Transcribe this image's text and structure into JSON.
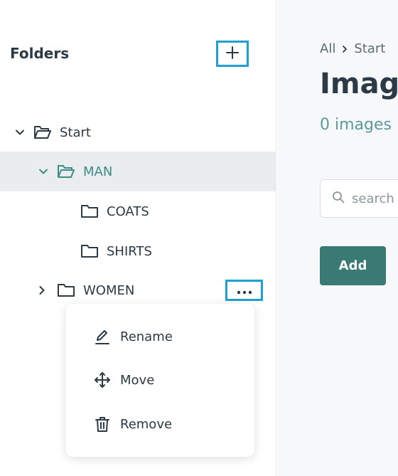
{
  "sidebar": {
    "title": "Folders",
    "add_folder_icon": "plus-icon",
    "tree": [
      {
        "label": "Start",
        "expanded": true,
        "icon": "folder-open-icon"
      },
      {
        "label": "MAN",
        "expanded": true,
        "selected": true,
        "icon": "folder-open-icon"
      },
      {
        "label": "COATS",
        "icon": "folder-icon"
      },
      {
        "label": "SHIRTS",
        "icon": "folder-icon"
      },
      {
        "label": "WOMEN",
        "expanded": false,
        "icon": "folder-icon"
      }
    ],
    "more_icon": "more-horizontal-icon"
  },
  "context_menu": {
    "items": [
      {
        "label": "Rename",
        "icon": "pencil-icon"
      },
      {
        "label": "Move",
        "icon": "move-arrows-icon"
      },
      {
        "label": "Remove",
        "icon": "trash-icon"
      }
    ]
  },
  "main": {
    "breadcrumb": [
      "All",
      "Start"
    ],
    "title": "Images",
    "count_text": "0 images",
    "search": {
      "placeholder": "search"
    },
    "add_label": "Add"
  },
  "colors": {
    "accent": "#3e8c84",
    "highlight_border": "#1ea0d0",
    "add_button": "#3a7a74",
    "selected_row": "#e9edf0"
  }
}
